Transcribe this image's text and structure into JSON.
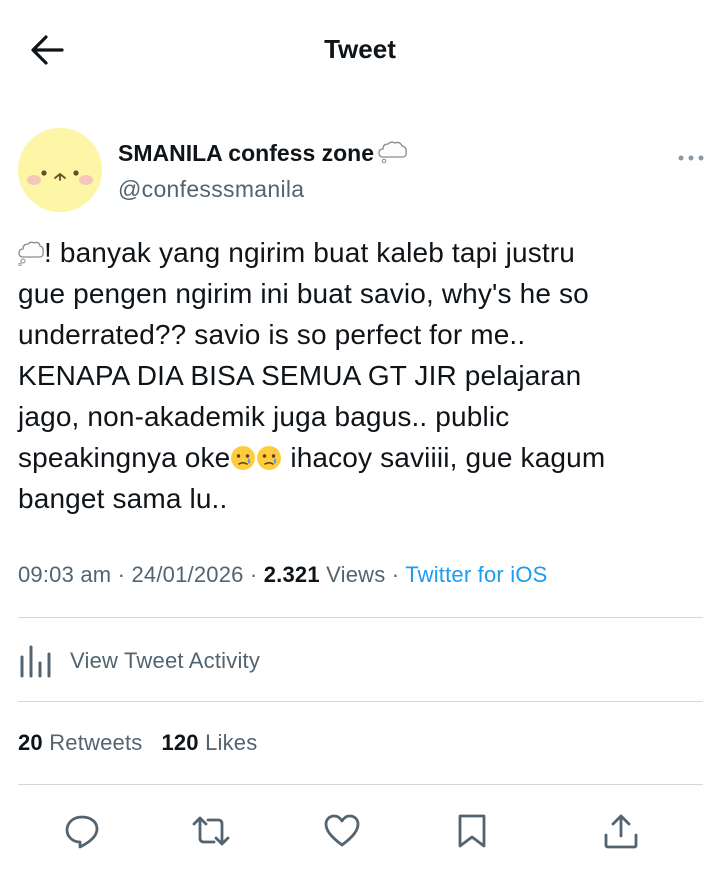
{
  "header": {
    "title": "Tweet",
    "back_icon": "arrow-left-icon"
  },
  "author": {
    "display_name": "SMANILA confess zone",
    "handle": "@confesssmanila",
    "name_emoji": "thought-balloon-icon"
  },
  "tweet": {
    "lines": [
      "! banyak yang ngirim buat kaleb tapi justru",
      "gue pengen ngirim ini buat savio, why's he so",
      "underrated?? savio is so perfect for me..",
      "KENAPA DIA BISA SEMUA GT JIR pelajaran",
      "jago, non-akademik juga bagus.. public",
      "speakingnya oke",
      " ihacoy saviiii, gue kagum",
      "banget sama lu.."
    ],
    "emojis": [
      "thought-balloon-icon",
      "face-holding-back-tears-icon",
      "face-holding-back-tears-icon"
    ]
  },
  "meta": {
    "time": "09:03 am",
    "date": "24/01/2026",
    "views_count": "2.321",
    "views_label": "Views",
    "source": "Twitter for iOS",
    "separator": " · "
  },
  "activity": {
    "label": "View Tweet Activity",
    "icon": "bar-chart-icon"
  },
  "stats": {
    "retweets_count": "20",
    "retweets_label": "Retweets",
    "likes_count": "120",
    "likes_label": "Likes"
  },
  "actions": [
    "reply-icon",
    "retweet-icon",
    "like-icon",
    "bookmark-icon",
    "share-icon"
  ],
  "colors": {
    "link": "#1d9bf0",
    "secondary_text": "#536471",
    "divider": "#cfd9de",
    "avatar_bg": "#fdf6a6"
  }
}
